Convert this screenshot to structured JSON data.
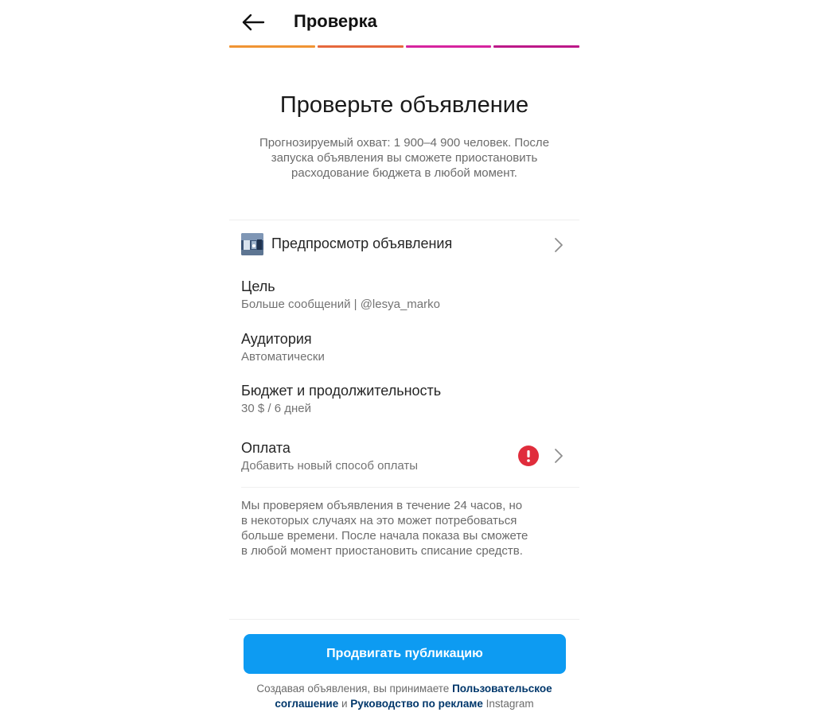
{
  "header": {
    "title": "Проверка",
    "back_icon": "arrow-left-icon"
  },
  "progress": {
    "steps_total": 4,
    "steps_completed": 4,
    "colors": [
      "#f09433",
      "#e6683c",
      "#dc2743",
      "#bc1888"
    ]
  },
  "intro": {
    "title": "Проверьте объявление",
    "subtitle_lines": [
      "Прогнозируемый охват: 1 900–4 900 человек. После",
      "запуска объявления вы сможете приостановить",
      "расходование бюджета в любой момент."
    ]
  },
  "rows": {
    "preview": {
      "label": "Предпросмотр объявления",
      "icon": "chevron-right-icon"
    },
    "goal": {
      "title": "Цель",
      "value": "Больше сообщений | @lesya_marko"
    },
    "audience": {
      "title": "Аудитория",
      "value": "Автоматически"
    },
    "budget": {
      "title": "Бюджет и продолжительность",
      "value": "30 $ / 6 дней"
    },
    "payment": {
      "title": "Оплата",
      "value": "Добавить новый способ оплаты",
      "alert_icon": "exclamation-alert-icon",
      "alert_color": "#e02d3c"
    }
  },
  "note": {
    "lines": [
      "Мы проверяем объявления в течение 24 часов, но",
      "в некоторых случаях на это может потребоваться",
      "больше времени. После начала показа вы сможете",
      "в любой момент приостановить списание средств."
    ]
  },
  "footer": {
    "button_label": "Продвигать публикацию",
    "button_color": "#0d9bf2",
    "terms_prefix": "Создавая объявления, вы принимаете ",
    "terms_link1": "Пользовательское соглашение",
    "terms_middle": " и ",
    "terms_link2": "Руководство по рекламе",
    "terms_suffix": " Instagram"
  }
}
